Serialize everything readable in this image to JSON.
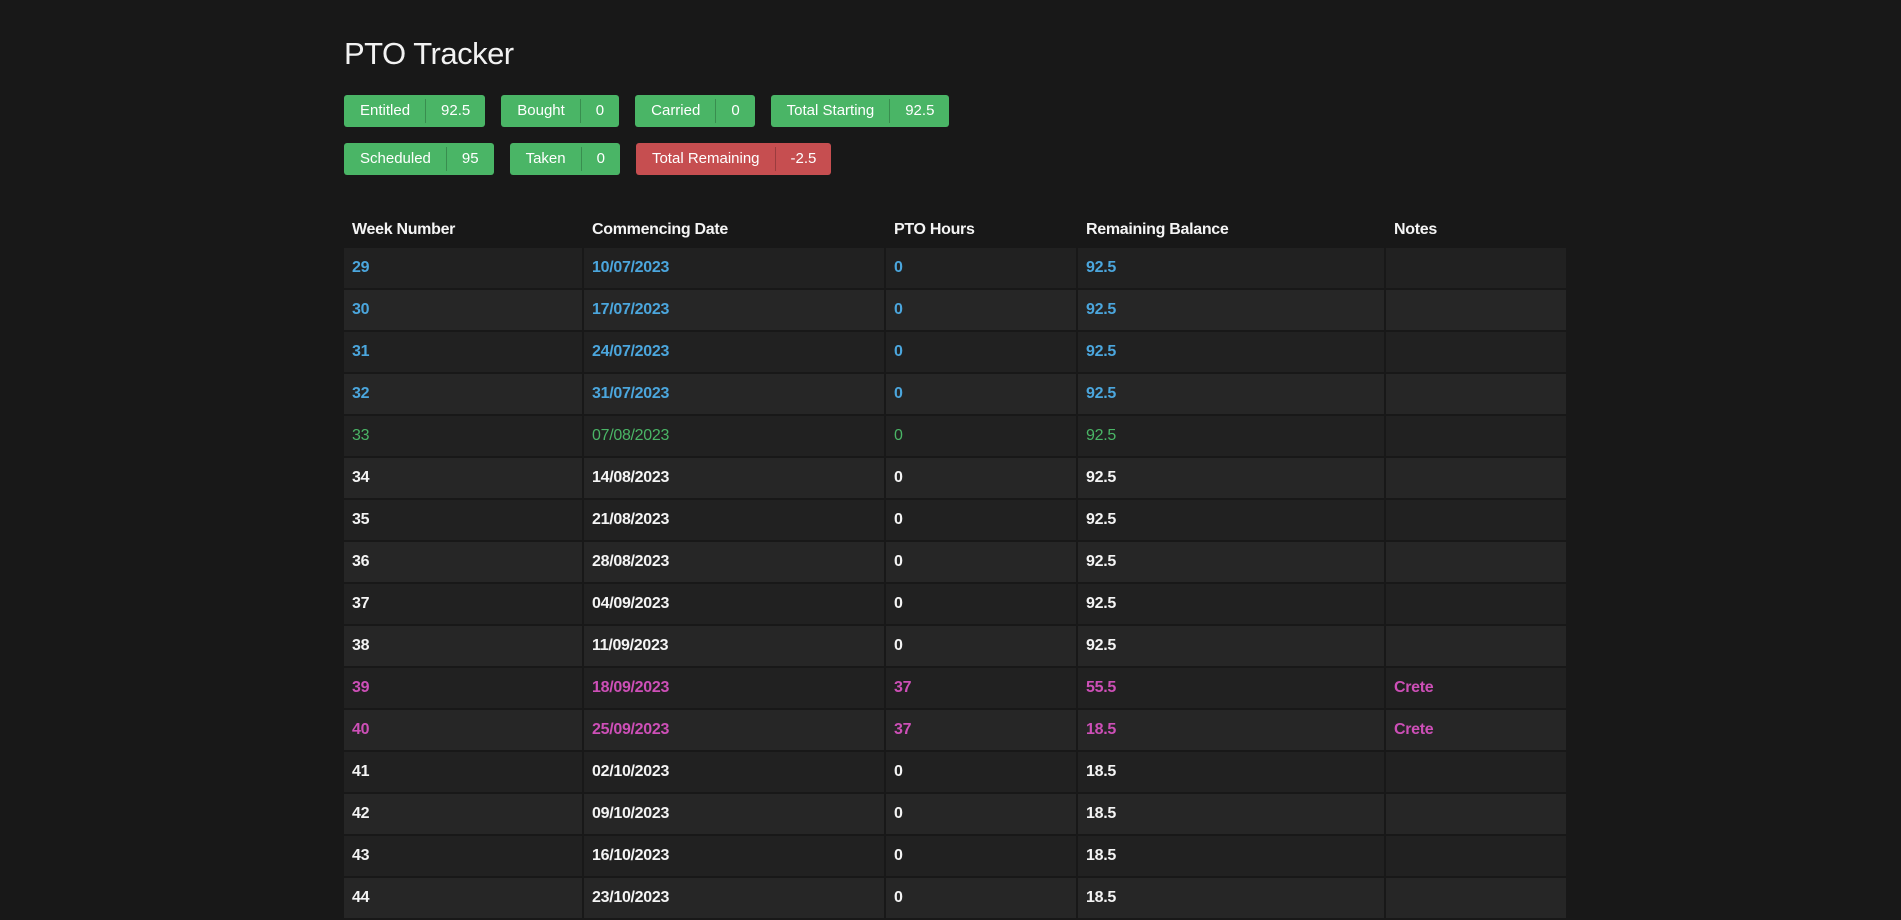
{
  "title": "PTO Tracker",
  "summary_row1": [
    {
      "label": "Entitled",
      "value": "92.5",
      "status": "ok"
    },
    {
      "label": "Bought",
      "value": "0",
      "status": "ok"
    },
    {
      "label": "Carried",
      "value": "0",
      "status": "ok"
    },
    {
      "label": "Total Starting",
      "value": "92.5",
      "status": "ok"
    }
  ],
  "summary_row2": [
    {
      "label": "Scheduled",
      "value": "95",
      "status": "ok"
    },
    {
      "label": "Taken",
      "value": "0",
      "status": "ok"
    },
    {
      "label": "Total Remaining",
      "value": "-2.5",
      "status": "danger"
    }
  ],
  "colors": {
    "ok": "#4ab566",
    "danger": "#c64e50",
    "past": "#4ba6dd",
    "current": "#4ab566",
    "pto": "#cd4fb7",
    "default": "#f4f4f4"
  },
  "table": {
    "headers": [
      "Week Number",
      "Commencing Date",
      "PTO Hours",
      "Remaining Balance",
      "Notes"
    ],
    "rows": [
      {
        "week": "29",
        "date": "10/07/2023",
        "hours": "0",
        "balance": "92.5",
        "notes": "",
        "state": "past"
      },
      {
        "week": "30",
        "date": "17/07/2023",
        "hours": "0",
        "balance": "92.5",
        "notes": "",
        "state": "past"
      },
      {
        "week": "31",
        "date": "24/07/2023",
        "hours": "0",
        "balance": "92.5",
        "notes": "",
        "state": "past"
      },
      {
        "week": "32",
        "date": "31/07/2023",
        "hours": "0",
        "balance": "92.5",
        "notes": "",
        "state": "past"
      },
      {
        "week": "33",
        "date": "07/08/2023",
        "hours": "0",
        "balance": "92.5",
        "notes": "",
        "state": "current"
      },
      {
        "week": "34",
        "date": "14/08/2023",
        "hours": "0",
        "balance": "92.5",
        "notes": "",
        "state": "future"
      },
      {
        "week": "35",
        "date": "21/08/2023",
        "hours": "0",
        "balance": "92.5",
        "notes": "",
        "state": "future"
      },
      {
        "week": "36",
        "date": "28/08/2023",
        "hours": "0",
        "balance": "92.5",
        "notes": "",
        "state": "future"
      },
      {
        "week": "37",
        "date": "04/09/2023",
        "hours": "0",
        "balance": "92.5",
        "notes": "",
        "state": "future"
      },
      {
        "week": "38",
        "date": "11/09/2023",
        "hours": "0",
        "balance": "92.5",
        "notes": "",
        "state": "future"
      },
      {
        "week": "39",
        "date": "18/09/2023",
        "hours": "37",
        "balance": "55.5",
        "notes": "Crete",
        "state": "pto"
      },
      {
        "week": "40",
        "date": "25/09/2023",
        "hours": "37",
        "balance": "18.5",
        "notes": "Crete",
        "state": "pto"
      },
      {
        "week": "41",
        "date": "02/10/2023",
        "hours": "0",
        "balance": "18.5",
        "notes": "",
        "state": "future"
      },
      {
        "week": "42",
        "date": "09/10/2023",
        "hours": "0",
        "balance": "18.5",
        "notes": "",
        "state": "future"
      },
      {
        "week": "43",
        "date": "16/10/2023",
        "hours": "0",
        "balance": "18.5",
        "notes": "",
        "state": "future"
      },
      {
        "week": "44",
        "date": "23/10/2023",
        "hours": "0",
        "balance": "18.5",
        "notes": "",
        "state": "future"
      }
    ]
  }
}
